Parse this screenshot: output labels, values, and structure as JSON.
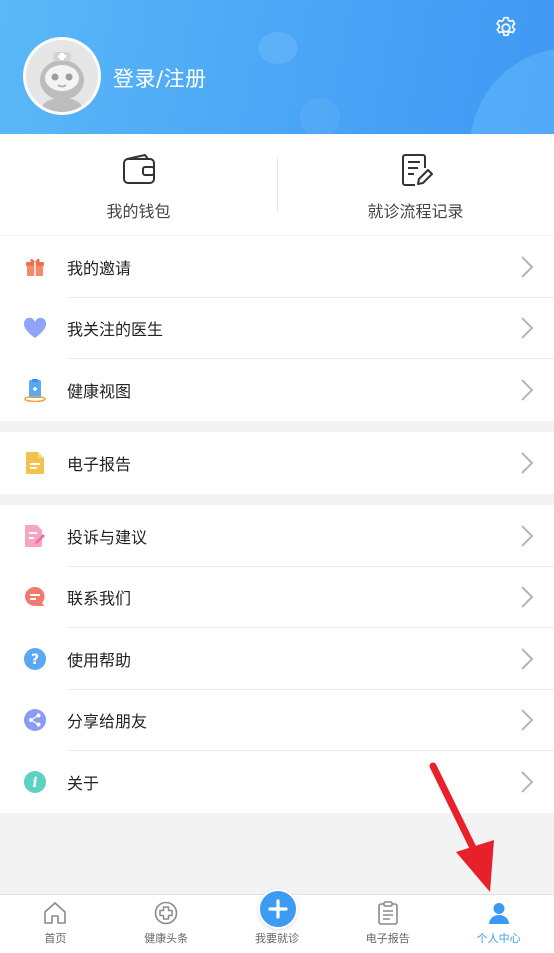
{
  "header": {
    "login_label": "登录/注册",
    "icons": {
      "avatar": "robot-doctor-avatar",
      "settings": "gear-icon"
    }
  },
  "quick_actions": [
    {
      "label": "我的钱包",
      "icon": "wallet-icon"
    },
    {
      "label": "就诊流程记录",
      "icon": "record-edit-icon"
    }
  ],
  "menu_groups": [
    [
      {
        "label": "我的邀请",
        "icon": "gift-icon",
        "color": "#f58a6b"
      },
      {
        "label": "我关注的医生",
        "icon": "heart-icon",
        "color": "#8ea5f5"
      },
      {
        "label": "健康视图",
        "icon": "health-view-icon",
        "color": "#3b8ee8"
      }
    ],
    [
      {
        "label": "电子报告",
        "icon": "report-file-icon",
        "color": "#f3c24d"
      }
    ],
    [
      {
        "label": "投诉与建议",
        "icon": "feedback-icon",
        "color": "#f17fa8"
      },
      {
        "label": "联系我们",
        "icon": "chat-icon",
        "color": "#f07a6e"
      },
      {
        "label": "使用帮助",
        "icon": "help-icon",
        "color": "#5aa8f2"
      },
      {
        "label": "分享给朋友",
        "icon": "share-icon",
        "color": "#8c9bf3"
      },
      {
        "label": "关于",
        "icon": "info-icon",
        "color": "#5ed1c2"
      }
    ]
  ],
  "bottom_nav": [
    {
      "label": "首页",
      "icon": "home-icon",
      "active": false
    },
    {
      "label": "健康头条",
      "icon": "medical-cross-icon",
      "active": false
    },
    {
      "label": "我要就诊",
      "icon": "plus-icon",
      "active": false
    },
    {
      "label": "电子报告",
      "icon": "clipboard-icon",
      "active": false
    },
    {
      "label": "个人中心",
      "icon": "person-icon",
      "active": true
    }
  ],
  "colors": {
    "accent": "#3a9af3",
    "header_start": "#5ab8f7",
    "header_end": "#3f99f4",
    "annotation_arrow": "#e8202a"
  }
}
